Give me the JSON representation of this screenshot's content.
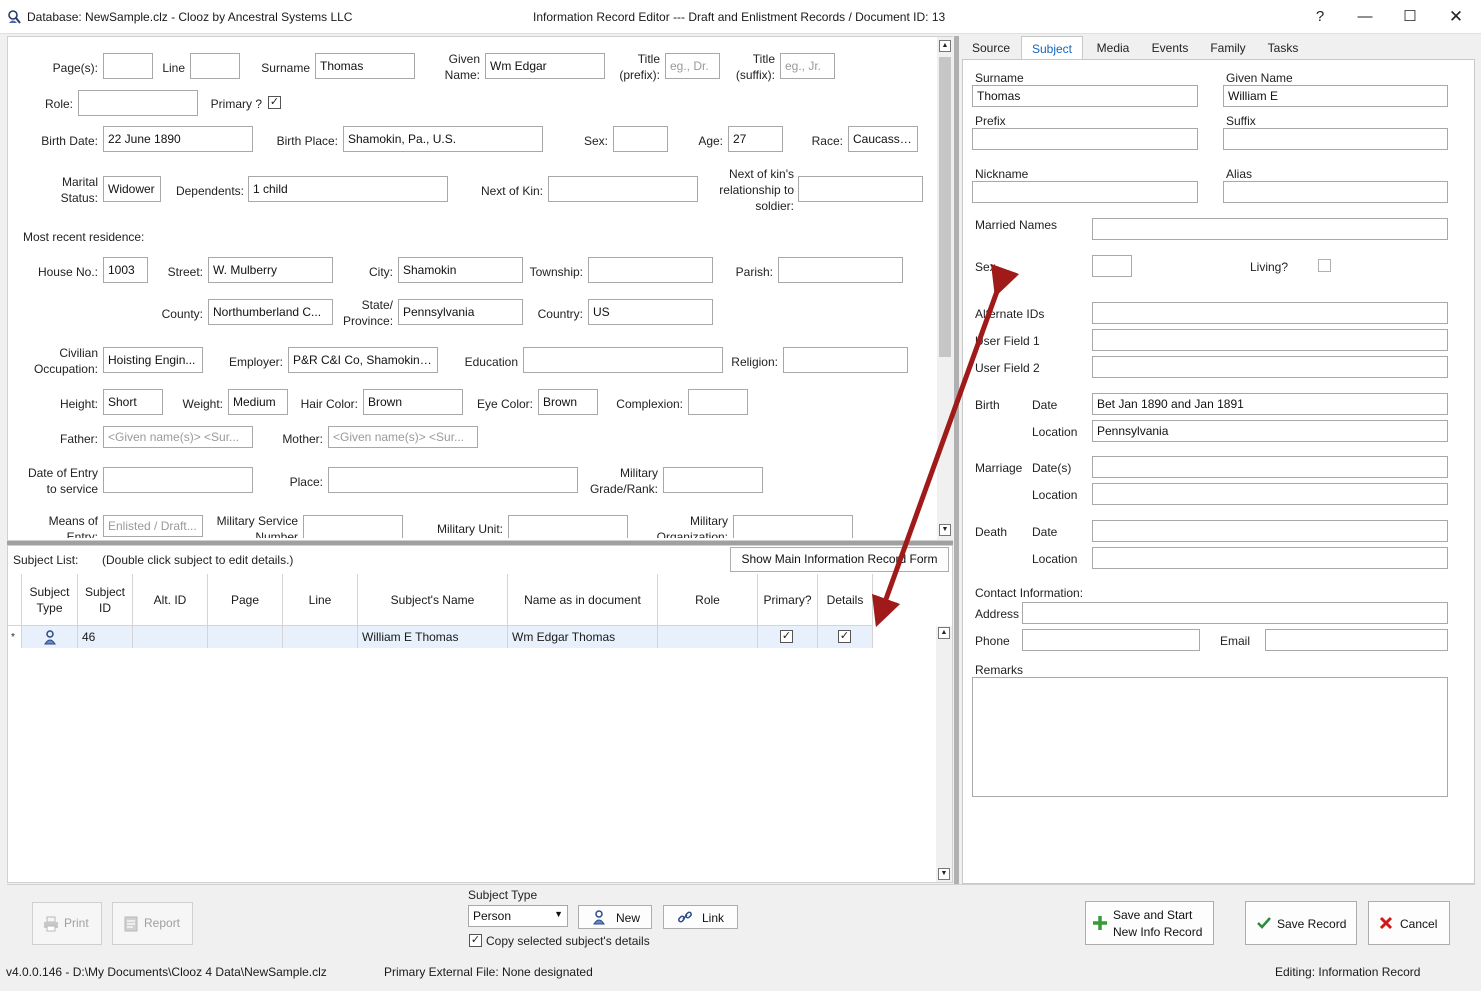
{
  "window": {
    "title_left": "Database: NewSample.clz - Clooz by Ancestral Systems LLC",
    "title_center": "Information Record Editor --- Draft and Enlistment Records /  Document ID: 13",
    "help": "?"
  },
  "form": {
    "pages_label": "Page(s):",
    "pages_value": "",
    "line_label": "Line",
    "line_value": "",
    "surname_label": "Surname",
    "surname_value": "Thomas",
    "given_label": "Given Name:",
    "given_value": "Wm Edgar",
    "title_prefix_label": "Title (prefix):",
    "title_prefix_placeholder": "eg., Dr.",
    "title_suffix_label": "Title (suffix):",
    "title_suffix_placeholder": "eg., Jr.",
    "role_label": "Role:",
    "role_value": "",
    "primary_label": "Primary ?",
    "primary_checked": "✓",
    "birth_date_label": "Birth Date:",
    "birth_date_value": "22 June 1890",
    "birth_place_label": "Birth Place:",
    "birth_place_value": "Shamokin, Pa., U.S.",
    "sex_label": "Sex:",
    "sex_value": "",
    "age_label": "Age:",
    "age_value": "27",
    "race_label": "Race:",
    "race_value": "Caucassian",
    "marital_label": "Marital Status:",
    "marital_value": "Widower",
    "dependents_label": "Dependents:",
    "dependents_value": "1 child",
    "next_of_kin_label": "Next of Kin:",
    "next_of_kin_value": "",
    "nok_rel_label": "Next of kin's relationship to soldier:",
    "nok_rel_value": "",
    "residence_label": "Most recent residence:",
    "house_label": "House No.:",
    "house_value": "1003",
    "street_label": "Street:",
    "street_value": "W. Mulberry",
    "city_label": "City:",
    "city_value": "Shamokin",
    "township_label": "Township:",
    "township_value": "",
    "parish_label": "Parish:",
    "parish_value": "",
    "county_label": "County:",
    "county_value": "Northumberland C...",
    "state_label": "State/ Province:",
    "state_value": "Pennsylvania",
    "country_label": "Country:",
    "country_value": "US",
    "occupation_label": "Civilian Occupation:",
    "occupation_value": "Hoisting Engin...",
    "employer_label": "Employer:",
    "employer_value": "P&R C&I Co, Shamokin,...",
    "education_label": "Education",
    "education_value": "",
    "religion_label": "Religion:",
    "religion_value": "",
    "height_label": "Height:",
    "height_value": "Short",
    "weight_label": "Weight:",
    "weight_value": "Medium",
    "hair_label": "Hair Color:",
    "hair_value": "Brown",
    "eye_label": "Eye Color:",
    "eye_value": "Brown",
    "complexion_label": "Complexion:",
    "complexion_value": "",
    "father_label": "Father:",
    "father_placeholder": "<Given name(s)>   <Sur...",
    "mother_label": "Mother:",
    "mother_placeholder": "<Given name(s)>   <Sur...",
    "entry_date_label": "Date of Entry to service",
    "entry_date_value": "",
    "place_label": "Place:",
    "place_value": "",
    "grade_label": "Military Grade/Rank:",
    "grade_value": "",
    "means_label": "Means of Entry:",
    "means_placeholder": "Enlisted / Draft...",
    "service_no_label": "Military Service Number",
    "service_no_value": "",
    "unit_label": "Military Unit:",
    "unit_value": "",
    "org_label": "Military Organization:",
    "org_value": ""
  },
  "subject_list": {
    "label": "Subject List:",
    "hint": "(Double click subject to edit details.)",
    "show_main_button": "Show Main Information Record Form",
    "columns": [
      "Subject Type",
      "Subject ID",
      "Alt. ID",
      "Page",
      "Line",
      "Subject's Name",
      "Name as in document",
      "Role",
      "Primary?",
      "Details"
    ],
    "row": {
      "marker": "*",
      "subject_id": "46",
      "alt_id": "",
      "page": "",
      "line": "",
      "name": "William E Thomas",
      "name_in_doc": "Wm Edgar Thomas",
      "role": "",
      "primary": "✓",
      "details": "✓"
    }
  },
  "tabs": [
    "Source",
    "Subject",
    "Media",
    "Events",
    "Family",
    "Tasks"
  ],
  "subject_panel": {
    "surname_label": "Surname",
    "surname_value": "Thomas",
    "given_label": "Given Name",
    "given_value": "William E",
    "prefix_label": "Prefix",
    "suffix_label": "Suffix",
    "nickname_label": "Nickname",
    "alias_label": "Alias",
    "married_label": "Married Names",
    "sex_label": "Sex",
    "living_label": "Living?",
    "alt_ids_label": "Alternate IDs",
    "user1_label": "User Field 1",
    "user2_label": "User Field 2",
    "birth_label": "Birth",
    "date_label": "Date",
    "location_label": "Location",
    "birth_date_value": "Bet Jan 1890 and Jan 1891",
    "birth_location_value": "Pennsylvania",
    "marriage_label": "Marriage",
    "dates_label": "Date(s)",
    "death_label": "Death",
    "contact_label": "Contact Information:",
    "address_label": "Address",
    "phone_label": "Phone",
    "email_label": "Email",
    "remarks_label": "Remarks"
  },
  "bottom": {
    "print": "Print",
    "report": "Report",
    "subject_type_label": "Subject Type",
    "subject_type_value": "Person",
    "new_button": "New",
    "link_button": "Link",
    "copy_label": "Copy selected subject's details",
    "save_start_1": "Save and Start",
    "save_start_2": "New Info Record",
    "save_record": "Save Record",
    "cancel": "Cancel"
  },
  "status": {
    "version_path": "v4.0.0.146  - D:\\My Documents\\Clooz 4 Data\\NewSample.clz",
    "primary_file": "Primary External File: None designated",
    "editing": "Editing: Information Record"
  },
  "colors": {
    "accent": "#1565c0",
    "arrow": "#a11a1a",
    "selected_row": "#e7f0fb",
    "cancel_x": "#d01818",
    "save_check": "#2e8b3a",
    "plus": "#3a9a3a"
  }
}
